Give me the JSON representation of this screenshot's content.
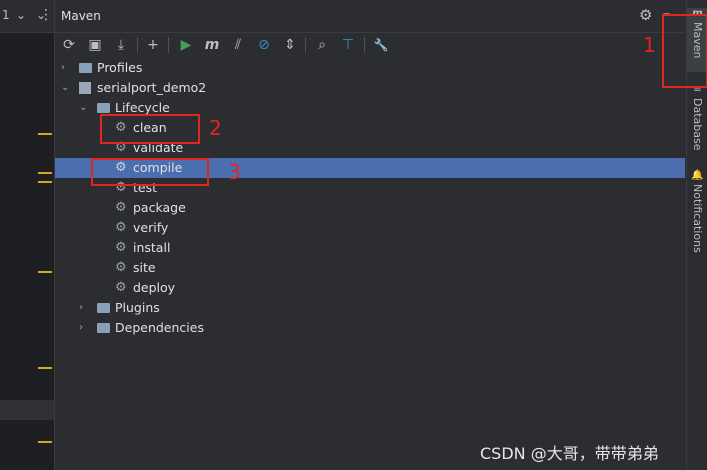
{
  "left_strip": {
    "line_num": "1",
    "menu_glyph": "⋮"
  },
  "panel": {
    "title": "Maven",
    "header_icons": [
      "gear-icon",
      "minimize-icon"
    ]
  },
  "toolbar": {
    "buttons": [
      {
        "name": "reload-icon",
        "glyph": "⟳"
      },
      {
        "name": "add-maven-project-icon",
        "glyph": "▣"
      },
      {
        "name": "download-icon",
        "glyph": "⤓"
      },
      {
        "name": "add-icon",
        "glyph": "+"
      },
      {
        "name": "run-icon",
        "glyph": "▶"
      },
      {
        "name": "execute-goal-icon",
        "glyph": "m"
      },
      {
        "name": "toggle-offline-icon",
        "glyph": "⫽"
      },
      {
        "name": "skip-tests-icon",
        "glyph": "⊘"
      },
      {
        "name": "collapse-all-icon",
        "glyph": "⇕"
      },
      {
        "name": "analyze-dependencies-icon",
        "glyph": "⌕"
      },
      {
        "name": "show-diagram-icon",
        "glyph": "⊤"
      },
      {
        "name": "settings-wrench-icon",
        "glyph": "🔧"
      }
    ]
  },
  "tree": {
    "profiles": "Profiles",
    "project": "serialport_demo2",
    "lifecycle": "Lifecycle",
    "goals": [
      "clean",
      "validate",
      "compile",
      "test",
      "package",
      "verify",
      "install",
      "site",
      "deploy"
    ],
    "plugins": "Plugins",
    "dependencies": "Dependencies"
  },
  "annotations": [
    "1",
    "2",
    "3"
  ],
  "right_bar": {
    "tabs": [
      "Maven",
      "Database",
      "Notifications"
    ],
    "maven_icon_glyph": "m",
    "database_icon_glyph": "≡",
    "notifications_icon_glyph": "🔔"
  },
  "watermark": "CSDN @大哥，带带弟弟",
  "colors": {
    "selection": "#4b6eaf",
    "annotation": "#e0261e",
    "run_green": "#499c54",
    "blue_icon": "#3592c4"
  }
}
